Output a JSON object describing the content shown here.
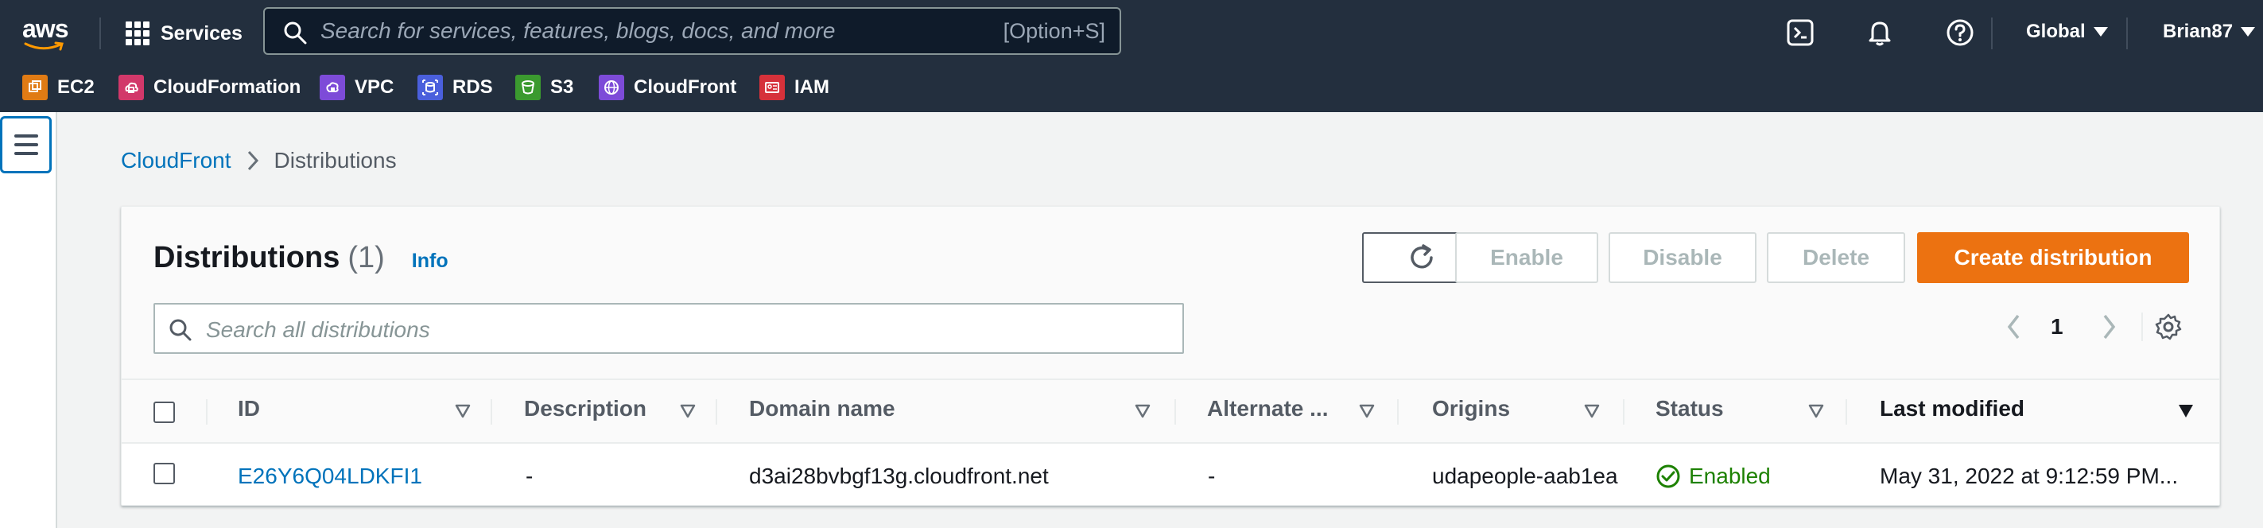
{
  "header": {
    "logo_text": "aws",
    "services_label": "Services",
    "search_placeholder": "Search for services, features, blogs, docs, and more",
    "search_shortcut": "[Option+S]",
    "region": "Global",
    "user": "Brian87"
  },
  "favorites": [
    {
      "label": "EC2",
      "color": "#e07b14",
      "icon": "ec2-icon"
    },
    {
      "label": "CloudFormation",
      "color": "#d2386a",
      "icon": "cloudformation-icon"
    },
    {
      "label": "VPC",
      "color": "#7d4bd8",
      "icon": "vpc-icon"
    },
    {
      "label": "RDS",
      "color": "#4a5fdc",
      "icon": "rds-icon"
    },
    {
      "label": "S3",
      "color": "#3b9a2f",
      "icon": "s3-icon"
    },
    {
      "label": "CloudFront",
      "color": "#7d4bd8",
      "icon": "cloudfront-icon"
    },
    {
      "label": "IAM",
      "color": "#d6313a",
      "icon": "iam-icon"
    }
  ],
  "breadcrumb": {
    "root": "CloudFront",
    "current": "Distributions"
  },
  "panel": {
    "title": "Distributions",
    "count": "(1)",
    "info": "Info",
    "buttons": {
      "enable": "Enable",
      "disable": "Disable",
      "delete": "Delete",
      "create": "Create distribution"
    },
    "search_placeholder": "Search all distributions",
    "page": "1"
  },
  "table": {
    "columns": [
      "ID",
      "Description",
      "Domain name",
      "Alternate ...",
      "Origins",
      "Status",
      "Last modified"
    ],
    "rows": [
      {
        "id": "E26Y6Q04LDKFI1",
        "description": "-",
        "domain": "d3ai28bvbgf13g.cloudfront.net",
        "alternate": "-",
        "origins": "udapeople-aab1ea",
        "status": "Enabled",
        "last_modified": "May 31, 2022 at 9:12:59 PM..."
      }
    ]
  },
  "colors": {
    "accent": "#ec7211",
    "link": "#0073bb",
    "nav_bg": "#232f3e",
    "success": "#1d8102"
  }
}
